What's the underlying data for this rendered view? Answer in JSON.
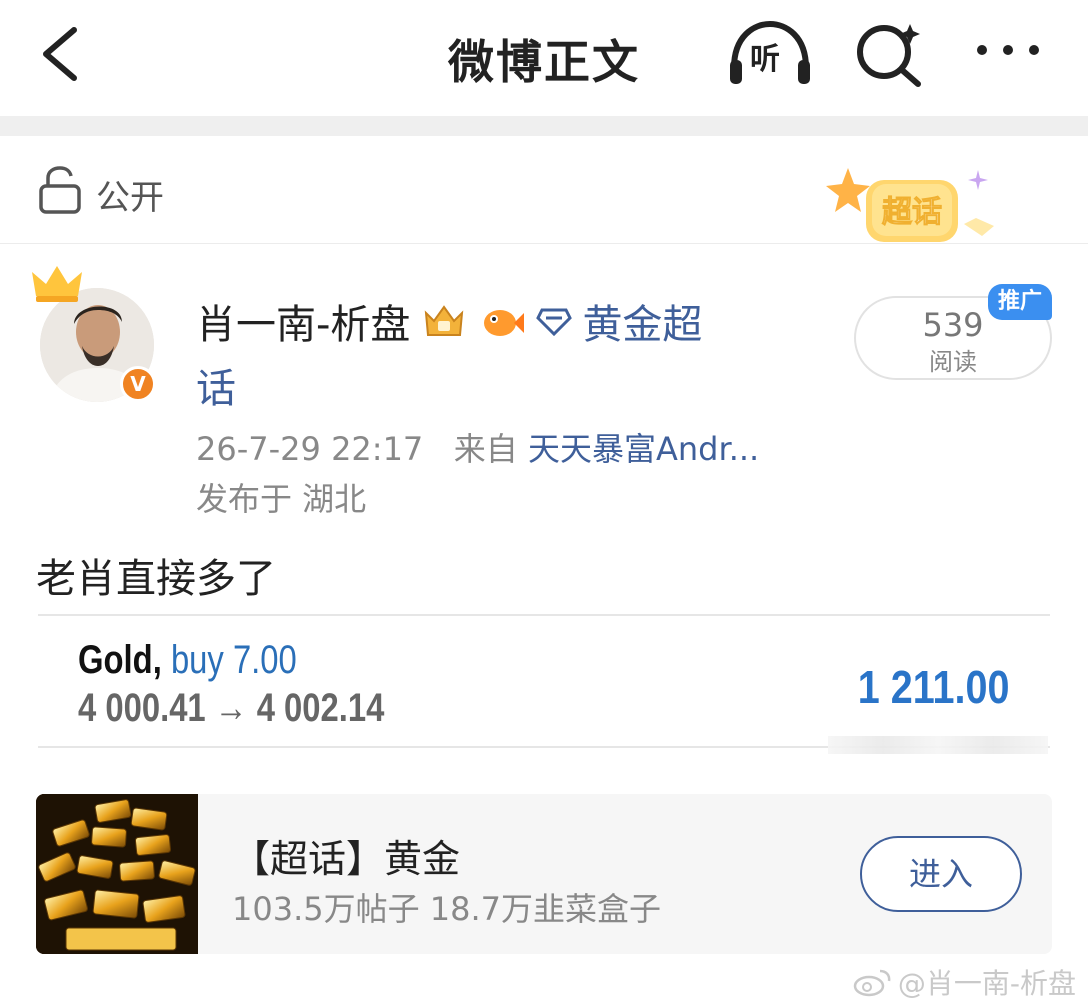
{
  "nav": {
    "title": "微博正文",
    "listen_label": "听"
  },
  "visibility": {
    "label": "公开",
    "badge": "超话"
  },
  "author": {
    "name": "肖一南-析盘",
    "topic_part1": "黄金超",
    "topic_part2": "话",
    "verified_mark": "V"
  },
  "meta": {
    "time": "26-7-29 22:17",
    "from_prefix": "来自",
    "source": "天天暴富Andr...",
    "location": "发布于 湖北"
  },
  "reads": {
    "count": "539",
    "label": "阅读",
    "promo": "推广"
  },
  "post": {
    "text": "老肖直接多了"
  },
  "trade": {
    "instrument": "Gold,",
    "action": "buy 7.00",
    "price_path": "4 000.41 → 4 002.14",
    "profit": "1 211.00"
  },
  "topic_card": {
    "title": "【超话】黄金",
    "stats": "103.5万帖子 18.7万韭菜盒子",
    "enter_label": "进入"
  },
  "watermark": {
    "text": "@肖一南-析盘"
  },
  "colors": {
    "link": "#3f5f9a",
    "accent_blue": "#2a74c8",
    "promo": "#3b8ff0",
    "verified": "#f08322"
  }
}
